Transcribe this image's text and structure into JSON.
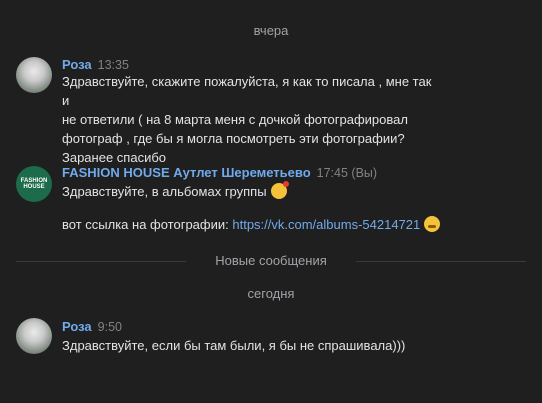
{
  "separators": {
    "yesterday": "вчера",
    "new_messages": "Новые сообщения",
    "today": "сегодня"
  },
  "messages": [
    {
      "author": "Роза",
      "time": "13:35",
      "lines": [
        "Здравствуйте, скажите пожалуйста, я как то писала , мне так и",
        "не ответили ( на 8 марта меня с дочкой фотографировал",
        "фотограф , где бы я могла посмотреть эти фотографии?",
        "Заранее спасибо"
      ],
      "avatar_icon": "user-photo-avatar"
    },
    {
      "author": "FASHION HOUSE Аутлет Шереметьево",
      "time": "17:45 (Вы)",
      "line1": "Здравствуйте, в альбомах группы",
      "line1_emoji": "smiling-face-with-hearts-emoji",
      "line2_prefix": "вот ссылка на фотографии: ",
      "line2_link": "https://vk.com/albums-54214721",
      "line2_emoji": "hugging-face-emoji",
      "avatar_logo_text": "FASHION HOUSE",
      "avatar_color": "#1c6b4b"
    },
    {
      "author": "Роза",
      "time": "9:50",
      "text": "Здравствуйте, если бы там были, я бы не спрашивала)))",
      "avatar_icon": "user-photo-avatar"
    }
  ],
  "colors": {
    "background": "#1f1f1f",
    "author": "#71aaeb",
    "text": "#e1e3e6",
    "muted": "#828282"
  }
}
